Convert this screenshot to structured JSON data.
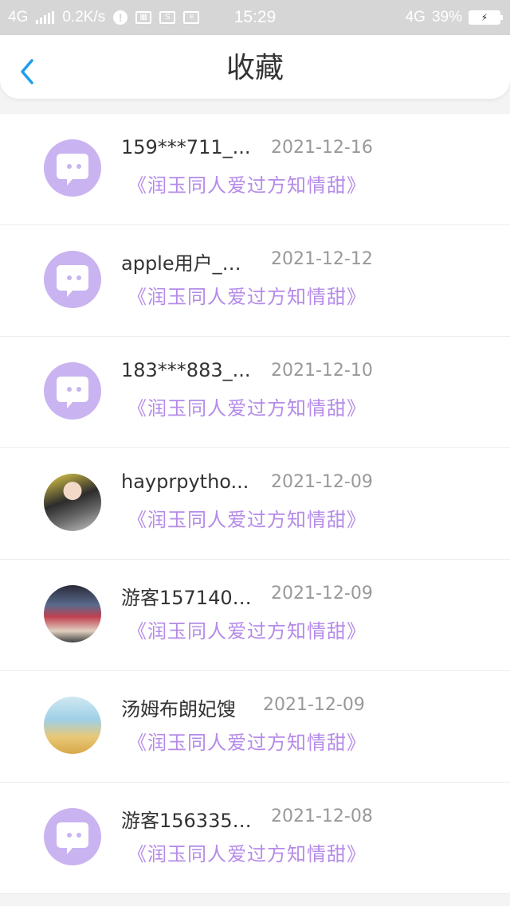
{
  "status_bar": {
    "network_left": "4G",
    "speed": "0.2K/s",
    "time": "15:29",
    "network_right": "4G",
    "battery": "39%"
  },
  "header": {
    "title": "收藏"
  },
  "items": [
    {
      "name": "159***711_...",
      "date": "2021-12-16",
      "novel": "《润玉同人爱过方知情甜》",
      "avatar": "default"
    },
    {
      "name": "apple用户_…",
      "date": "2021-12-12",
      "novel": "《润玉同人爱过方知情甜》",
      "avatar": "default"
    },
    {
      "name": "183***883_...",
      "date": "2021-12-10",
      "novel": "《润玉同人爱过方知情甜》",
      "avatar": "default"
    },
    {
      "name": "hayprpytho...",
      "date": "2021-12-09",
      "novel": "《润玉同人爱过方知情甜》",
      "avatar": "photo"
    },
    {
      "name": "游客157140…",
      "date": "2021-12-09",
      "novel": "《润玉同人爱过方知情甜》",
      "avatar": "photo"
    },
    {
      "name": "汤姆布朗妃馊",
      "date": "2021-12-09",
      "novel": "《润玉同人爱过方知情甜》",
      "avatar": "photo"
    },
    {
      "name": "游客156335…",
      "date": "2021-12-08",
      "novel": "《润玉同人爱过方知情甜》",
      "avatar": "default"
    }
  ],
  "colors": {
    "accent": "#1e9cf0",
    "novel_text": "#b58be8",
    "avatar_bg": "#c9b3f0"
  }
}
